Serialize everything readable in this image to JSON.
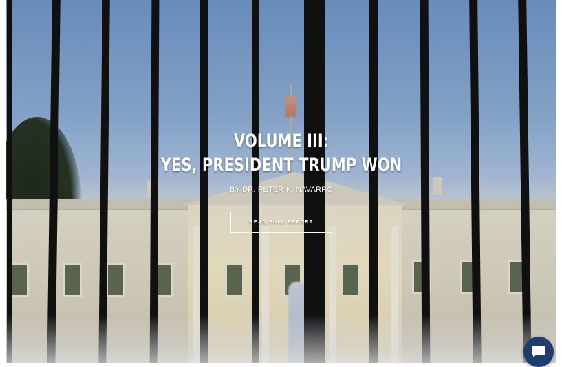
{
  "hero": {
    "title_line1": "VOLUME III:",
    "title_line2": "YES, PRESIDENT TRUMP WON",
    "byline": "BY DR. PETER K. NAVARRO",
    "cta_label": "READ FULL REPORT"
  },
  "chat_widget": {
    "icon": "chat-bubble-icon",
    "color": "#1d3c70"
  },
  "colors": {
    "title_text": "#ffffff",
    "button_border": "#ffffff"
  }
}
